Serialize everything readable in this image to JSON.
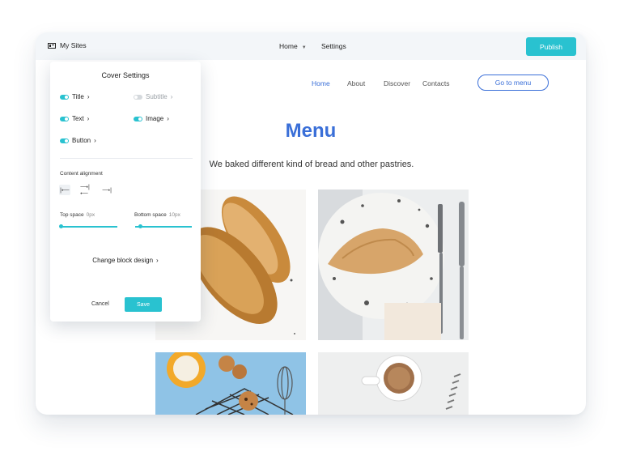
{
  "topbar": {
    "my_sites": "My Sites",
    "home": "Home",
    "settings": "Settings",
    "publish": "Publish"
  },
  "site": {
    "nav": [
      "Home",
      "About",
      "Discover",
      "Contacts"
    ],
    "cta": "Go to menu",
    "title": "Menu",
    "subtitle": "We baked different kind of bread and other pastries."
  },
  "panel": {
    "title": "Cover Settings",
    "toggles": [
      {
        "label": "Title",
        "on": true
      },
      {
        "label": "Subtitle",
        "on": false
      },
      {
        "label": "Text",
        "on": true
      },
      {
        "label": "Image",
        "on": true
      },
      {
        "label": "Button",
        "on": true
      }
    ],
    "content_alignment": "Content alignment",
    "align_icons": [
      "align-left-icon",
      "align-center-icon",
      "align-right-icon"
    ],
    "top_space_label": "Top space",
    "top_space_value": "0px",
    "bottom_space_label": "Bottom space",
    "bottom_space_value": "10px",
    "change_block": "Change block design",
    "cancel": "Cancel",
    "save": "Save"
  },
  "colors": {
    "accent": "#29c2d0",
    "brand_blue": "#3a6fd8"
  }
}
